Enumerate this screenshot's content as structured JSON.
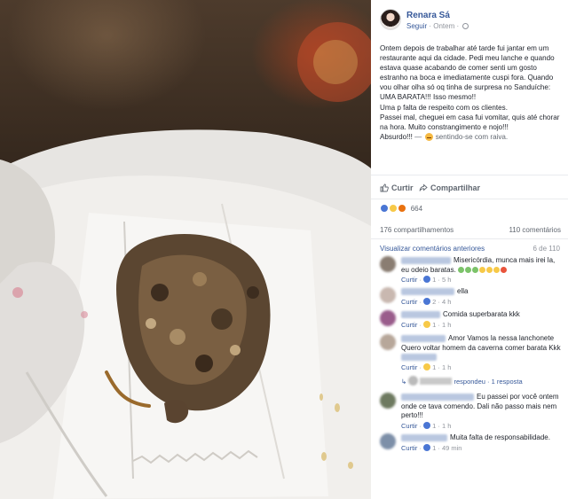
{
  "post": {
    "author": "Renara Sá",
    "follow_label": "Seguir",
    "time": "Ontem",
    "paragraphs": [
      "Ontem depois de trabalhar até tarde fui jantar em um restaurante aqui da cidade. Pedi meu lanche e quando estava quase acabando de comer senti um gosto estranho na boca e imediatamente cuspi fora. Quando vou olhar olha só oq tinha de surpresa no Sanduíche: UMA BARATA!!! Isso mesmo!!",
      "Uma p falta de respeito com os clientes.",
      "Passei mal, cheguei em casa fui vomitar, quis até chorar na hora. Muito constrangimento e nojo!!!"
    ],
    "final_word": "Absurdo!!!",
    "feeling_text": "sentindo-se com raiva."
  },
  "actions": {
    "like_label": "Curtir",
    "share_label": "Compartilhar"
  },
  "reactions": {
    "count": "664",
    "icons": [
      "like-icon",
      "wow-icon",
      "angry-icon"
    ]
  },
  "stats": {
    "shares": "176 compartilhamentos",
    "comments": "110 comentários"
  },
  "comments_section": {
    "view_previous": "Visualizar comentários anteriores",
    "page_count": "6 de 110",
    "items": [
      {
        "text": "Misericórdia, munca mais irei la, eu odeio baratas.",
        "like": "Curtir",
        "reacts": "1",
        "time": "5 h"
      },
      {
        "text": "ella",
        "like": "Curtir",
        "reacts": "2",
        "time": "4 h"
      },
      {
        "text": "Comida superbarata kkk",
        "like": "Curtir",
        "reacts": "1",
        "time": "1 h"
      },
      {
        "text": "Amor Vamos la nessa lanchonete Quero voltar homem da caverna comer barata Kkk",
        "like": "Curtir",
        "reacts": "1",
        "time": "1 h"
      },
      {
        "text": "Eu passei por você ontem onde ce tava comendo. Dali não passo mais nem perto!!!",
        "like": "Curtir",
        "reacts": "1",
        "time": "1 h"
      },
      {
        "text": "Muita falta de responsabilidade.",
        "like": "Curtir",
        "reacts": "1",
        "time": "49 min"
      }
    ],
    "reply": {
      "verb": "respondeu",
      "count": "1 resposta"
    }
  },
  "colors": {
    "link": "#365899",
    "muted": "#90949c",
    "text": "#1d2129"
  }
}
